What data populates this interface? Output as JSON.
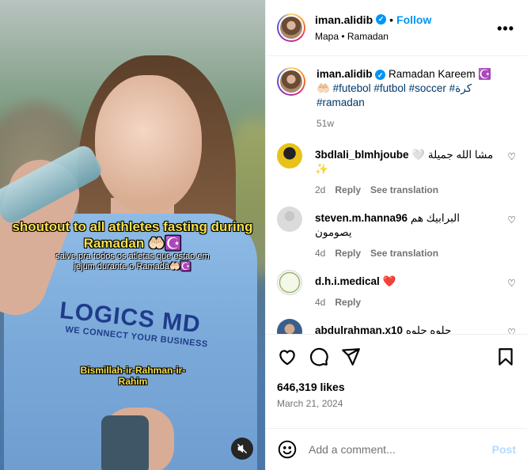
{
  "post": {
    "username": "iman.alidib",
    "follow_label": "Follow",
    "location": "Mapa • Ramadan",
    "more_label": "•••"
  },
  "media": {
    "caption_main": "shoutout to all athletes fasting during Ramadan 🤲🏻☪️",
    "caption_sub": "salve pra todos os atletas que estao em jejum durante o Ramadã🤲🏻☪️",
    "caption_bismillah": "Bismillah-ir-Rahman-ir-Rahim",
    "shirt_logo": "LOGICS MD",
    "shirt_sub": "WE CONNECT YOUR BUSINESS"
  },
  "caption": {
    "username": "iman.alidib",
    "text": "Ramadan Kareem ☪️",
    "line2_prefix": "🤲🏻",
    "tags": "#futebol #futbol #soccer #كرة",
    "tags2": "#ramadan",
    "age": "51w"
  },
  "comments": [
    {
      "username": "3bdlali_blmhjoube",
      "text": "مشا الله جميلة 🤍 ✨",
      "age": "2d",
      "reply": "Reply",
      "translate": "See translation"
    },
    {
      "username": "steven.m.hanna96",
      "text": "البرابيك هم يصومون",
      "age": "4d",
      "reply": "Reply",
      "translate": "See translation"
    },
    {
      "username": "d.h.i.medical",
      "text": "❤️",
      "age": "4d",
      "reply": "Reply",
      "translate": ""
    },
    {
      "username": "abdulrahman.x10",
      "text": "حلوه حلوه",
      "age": "",
      "reply": "",
      "translate": ""
    }
  ],
  "actions": {
    "likes": "646,319 likes",
    "date": "March 21, 2024"
  },
  "add_comment": {
    "placeholder": "Add a comment...",
    "post_label": "Post"
  },
  "colors": {
    "accent": "#0095f6",
    "caption_yellow": "#f7e14a",
    "muted": "#737373"
  }
}
